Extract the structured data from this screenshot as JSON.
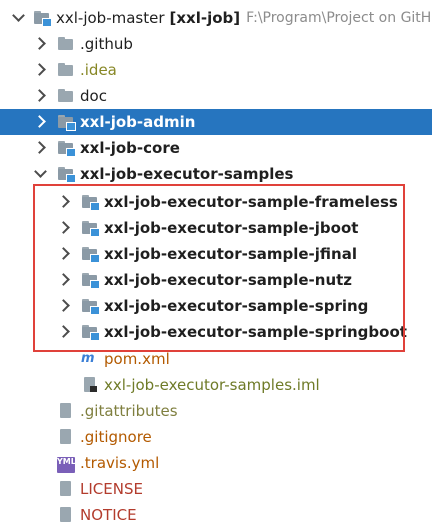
{
  "tree": {
    "root": {
      "name": "xxl-job-master",
      "module": "[xxl-job]",
      "path": "F:\\Program\\Project on GitH"
    },
    "items": [
      {
        "label": ".github",
        "icon": "folder-icon"
      },
      {
        "label": ".idea",
        "icon": "folder-icon"
      },
      {
        "label": "doc",
        "icon": "folder-icon"
      },
      {
        "label": "xxl-job-admin",
        "icon": "module-folder-icon",
        "selected": true
      },
      {
        "label": "xxl-job-core",
        "icon": "module-folder-icon"
      },
      {
        "label": "xxl-job-executor-samples",
        "icon": "module-folder-icon",
        "expanded": true
      },
      {
        "label": "xxl-job-executor-sample-frameless",
        "icon": "module-folder-icon"
      },
      {
        "label": "xxl-job-executor-sample-jboot",
        "icon": "module-folder-icon"
      },
      {
        "label": "xxl-job-executor-sample-jfinal",
        "icon": "module-folder-icon"
      },
      {
        "label": "xxl-job-executor-sample-nutz",
        "icon": "module-folder-icon"
      },
      {
        "label": "xxl-job-executor-sample-spring",
        "icon": "module-folder-icon"
      },
      {
        "label": "xxl-job-executor-sample-springboot",
        "icon": "module-folder-icon"
      },
      {
        "label": "pom.xml",
        "icon": "maven-icon"
      },
      {
        "label": "xxl-job-executor-samples.iml",
        "icon": "iml-file-icon"
      },
      {
        "label": ".gitattributes",
        "icon": "file-icon"
      },
      {
        "label": ".gitignore",
        "icon": "file-icon"
      },
      {
        "label": ".travis.yml",
        "icon": "yml-file-icon"
      },
      {
        "label": "LICENSE",
        "icon": "file-icon"
      },
      {
        "label": "NOTICE",
        "icon": "file-icon"
      }
    ],
    "icons": {
      "maven": "m",
      "yml": "YML"
    }
  },
  "colors": {
    "selection": "#2675bf",
    "highlight_box": "#e0413a",
    "module_marker": "#3b92d8"
  }
}
